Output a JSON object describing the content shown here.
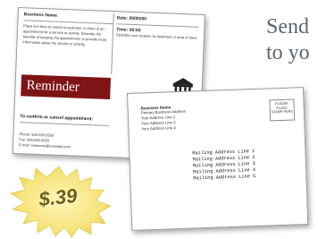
{
  "headline": {
    "line1": "Send",
    "line2": "to yo"
  },
  "reminder_card": {
    "business_name": "Business Name",
    "intro_text": "Place text here to remind a customer or client of an appointment for a service or activity. Describe the benefits of keeping the appointment, or provide more information about the service or activity.",
    "date_label": "Date: 00/00/00",
    "time_label": "Time: 00:00",
    "location_text": "Describe your location by landmark or area of town.",
    "banner_text": "Reminder",
    "confirm_heading": "To confirm or cancel appointment:",
    "phone": "Phone: 555-555-5555",
    "fax": "Fax: 555-555-5555",
    "email": "E-mail: someone@example.com",
    "banner_color": "#7e1416"
  },
  "mailing_card": {
    "return_name": "Business Name",
    "return_lines": [
      "Primary Business Address",
      "Your Address Line 2",
      "Your Address Line 3",
      "Your Address Line 4"
    ],
    "stamp_text": "PLEASE PLACE STAMP HERE",
    "mail_lines": [
      "Mailing Address Line 1",
      "Mailing Address Line 2",
      "Mailing Address Line 3",
      "Mailing Address Line 4",
      "Mailing Address Line 5"
    ]
  },
  "price": {
    "text": "$.39",
    "burst_color": "#f6e37a",
    "text_color": "#6c6018"
  },
  "icons": {
    "building": "building-icon",
    "burst": "starburst-icon"
  }
}
